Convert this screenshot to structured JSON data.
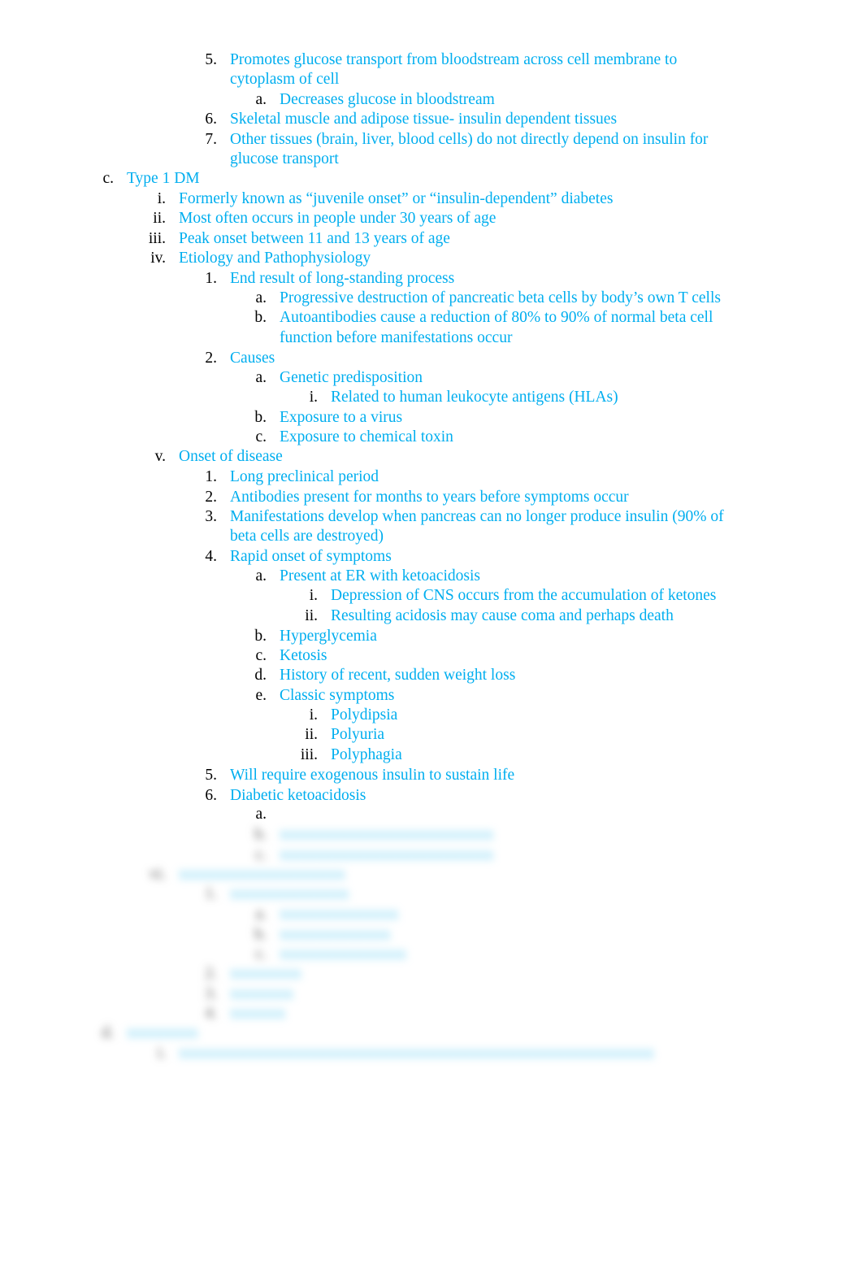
{
  "document": {
    "text_color": "#00aeef",
    "lines": [
      {
        "marker": "5.",
        "text": "Promotes glucose transport from bloodstream across cell membrane to"
      },
      {
        "marker": "",
        "text": "cytoplasm of cell"
      },
      {
        "marker": "a.",
        "text": "Decreases glucose in bloodstream"
      },
      {
        "marker": "6.",
        "text": "Skeletal muscle and adipose tissue- insulin dependent tissues"
      },
      {
        "marker": "7.",
        "text": "Other tissues (brain, liver, blood cells) do not directly depend on insulin for"
      },
      {
        "marker": "",
        "text": "glucose transport"
      },
      {
        "marker": "c.",
        "text": "Type 1 DM"
      },
      {
        "marker": "i.",
        "text": "Formerly known as “juvenile onset” or “insulin-dependent” diabetes"
      },
      {
        "marker": "ii.",
        "text": "Most often occurs in people under 30 years of age"
      },
      {
        "marker": "iii.",
        "text": "Peak onset between 11 and 13 years of age"
      },
      {
        "marker": "iv.",
        "text": "Etiology and Pathophysiology"
      },
      {
        "marker": "1.",
        "text": "End result of long-standing process"
      },
      {
        "marker": "a.",
        "text": "Progressive destruction of pancreatic beta cells by body’s own T cells"
      },
      {
        "marker": "b.",
        "text": "Autoantibodies cause a reduction of 80% to 90% of normal beta cell"
      },
      {
        "marker": "",
        "text": "function before manifestations occur"
      },
      {
        "marker": "2.",
        "text": "Causes"
      },
      {
        "marker": "a.",
        "text": "Genetic predisposition"
      },
      {
        "marker": "i.",
        "text": "Related to human leukocyte antigens (HLAs)"
      },
      {
        "marker": "b.",
        "text": "Exposure to a virus"
      },
      {
        "marker": "c.",
        "text": "Exposure to chemical toxin"
      },
      {
        "marker": "v.",
        "text": "Onset of disease"
      },
      {
        "marker": "1.",
        "text": "Long preclinical period"
      },
      {
        "marker": "2.",
        "text": "Antibodies present for months to years before symptoms occur"
      },
      {
        "marker": "3.",
        "text": "Manifestations develop when pancreas can no longer produce insulin (90% of"
      },
      {
        "marker": "",
        "text": "beta cells are destroyed)"
      },
      {
        "marker": "4.",
        "text": "Rapid onset of symptoms"
      },
      {
        "marker": "a.",
        "text": "Present at ER with ketoacidosis"
      },
      {
        "marker": "i.",
        "text": "Depression of CNS occurs from the accumulation of ketones"
      },
      {
        "marker": "ii.",
        "text": "Resulting acidosis may cause coma and perhaps death"
      },
      {
        "marker": "b.",
        "text": "Hyperglycemia"
      },
      {
        "marker": "c.",
        "text": "Ketosis"
      },
      {
        "marker": "d.",
        "text": "History of recent, sudden weight loss"
      },
      {
        "marker": "e.",
        "text": "Classic symptoms"
      },
      {
        "marker": "i.",
        "text": "Polydipsia"
      },
      {
        "marker": "ii.",
        "text": "Polyuria"
      },
      {
        "marker": "iii.",
        "text": "Polyphagia"
      },
      {
        "marker": "5.",
        "text": "Will require exogenous insulin to sustain life"
      },
      {
        "marker": "6.",
        "text": "Diabetic ketoacidosis"
      },
      {
        "marker": "a.",
        "text": ""
      }
    ],
    "blurred_lines": [
      {
        "marker": "b.",
        "text": "xxxxxxxxxxxxxxxxxxxxxxxxxxx"
      },
      {
        "marker": "c.",
        "text": "xxxxxxxxxxxxxxxxxxxxxxxxxxx"
      },
      {
        "marker": "vi.",
        "text": "xxxxxxxxxxxxxxxxxxxxx"
      },
      {
        "marker": "1.",
        "text": "xxxxxxxxxxxxxxx"
      },
      {
        "marker": "a.",
        "text": "xxxxxxxxxxxxxxx"
      },
      {
        "marker": "b.",
        "text": "xxxxxxxxxxxxxx"
      },
      {
        "marker": "c.",
        "text": "xxxxxxxxxxxxxxxx"
      },
      {
        "marker": "2.",
        "text": "xxxxxxxxx"
      },
      {
        "marker": "3.",
        "text": "xxxxxxxx"
      },
      {
        "marker": "4.",
        "text": "xxxxxxx"
      },
      {
        "marker": "d.",
        "text": "xxxxxxxxx"
      },
      {
        "marker": "i.",
        "text": "xxxxxxxxxxxxxxxxxxxxxxxxxxxxxxxxxxxxxxxxxxxxxxxxxxxxxxxxxxxx"
      }
    ]
  }
}
